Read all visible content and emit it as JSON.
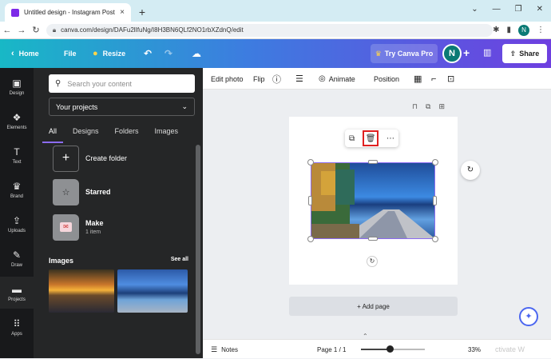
{
  "browser": {
    "tab_title": "Untitled design - Instagram Post",
    "tab_close": "×",
    "new_tab": "+",
    "url": "canva.com/design/DAFu2lIfuNg/I8H3BN6QLf2NO1rbXZdnQ/edit",
    "profile_initial": "N",
    "window_controls": [
      "⌄",
      "—",
      "❐",
      "✕"
    ]
  },
  "topbar": {
    "home": "Home",
    "file": "File",
    "resize": "Resize",
    "try_pro": "Try Canva Pro",
    "user_initial": "N",
    "share": "Share"
  },
  "rail": [
    {
      "label": "Design",
      "glyph": "▣"
    },
    {
      "label": "Elements",
      "glyph": "❖"
    },
    {
      "label": "Text",
      "glyph": "T"
    },
    {
      "label": "Brand",
      "glyph": "♛"
    },
    {
      "label": "Uploads",
      "glyph": "⇪"
    },
    {
      "label": "Draw",
      "glyph": "✎"
    },
    {
      "label": "Projects",
      "glyph": "▬"
    },
    {
      "label": "Apps",
      "glyph": "⠿"
    }
  ],
  "panel": {
    "search_placeholder": "Search your content",
    "projects_select": "Your projects",
    "tabs": [
      "All",
      "Designs",
      "Folders",
      "Images"
    ],
    "folders": [
      {
        "name": "Create folder",
        "sub": ""
      },
      {
        "name": "Starred",
        "sub": ""
      },
      {
        "name": "Make",
        "sub": "1 item"
      }
    ],
    "images_heading": "Images",
    "see_all": "See all"
  },
  "context_toolbar": {
    "edit_photo": "Edit photo",
    "flip": "Flip",
    "animate": "Animate",
    "position": "Position"
  },
  "canvas": {
    "add_page": "+ Add page"
  },
  "footer": {
    "notes": "Notes",
    "page_indicator": "Page 1 / 1",
    "zoom_value": 0.33,
    "zoom_label": "33%",
    "watermark": "ctivate W"
  },
  "colors": {
    "accent": "#8b6cf0",
    "delete_highlight": "#e02020",
    "topbar_start": "#18b8c6",
    "topbar_end": "#6e3fe0"
  }
}
